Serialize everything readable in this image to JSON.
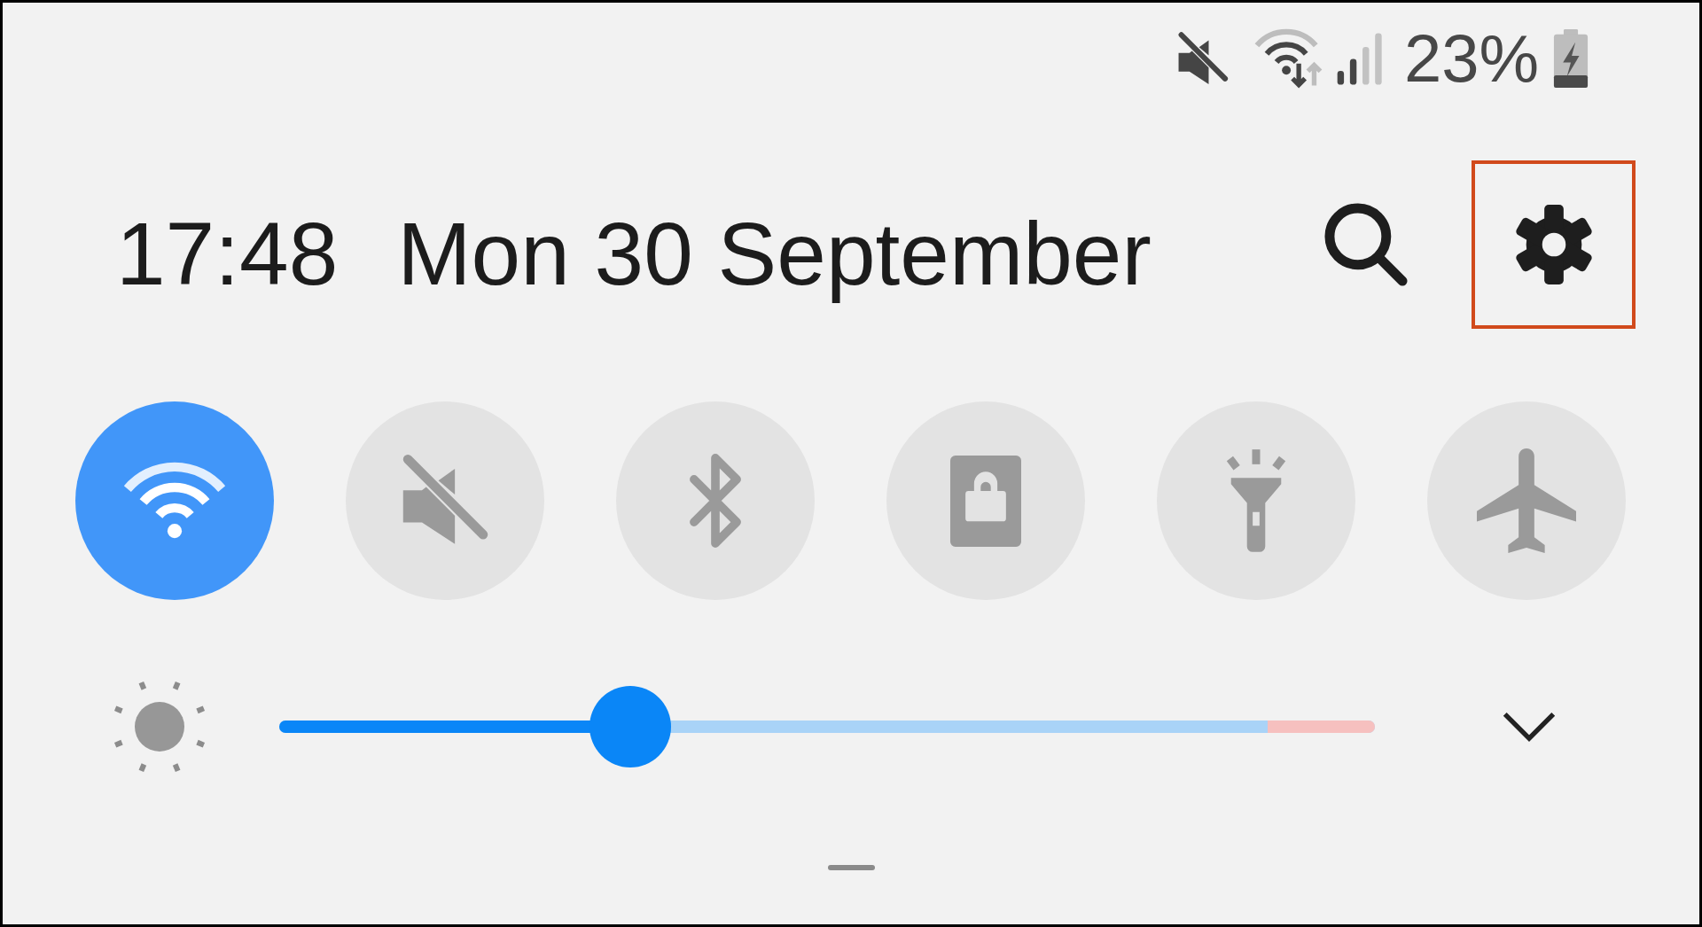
{
  "status_bar": {
    "battery_percent": "23%"
  },
  "header": {
    "time": "17:48",
    "date": "Mon 30 September"
  },
  "header_actions": [
    {
      "kind": "search",
      "highlighted": false
    },
    {
      "kind": "settings",
      "highlighted": true
    }
  ],
  "quick_toggles": [
    {
      "kind": "wifi",
      "on": true
    },
    {
      "kind": "sound",
      "on": false
    },
    {
      "kind": "bluetooth",
      "on": false
    },
    {
      "kind": "screen_lock",
      "on": false
    },
    {
      "kind": "flashlight",
      "on": false
    },
    {
      "kind": "airplane",
      "on": false
    }
  ],
  "brightness": {
    "level": 0.32
  }
}
